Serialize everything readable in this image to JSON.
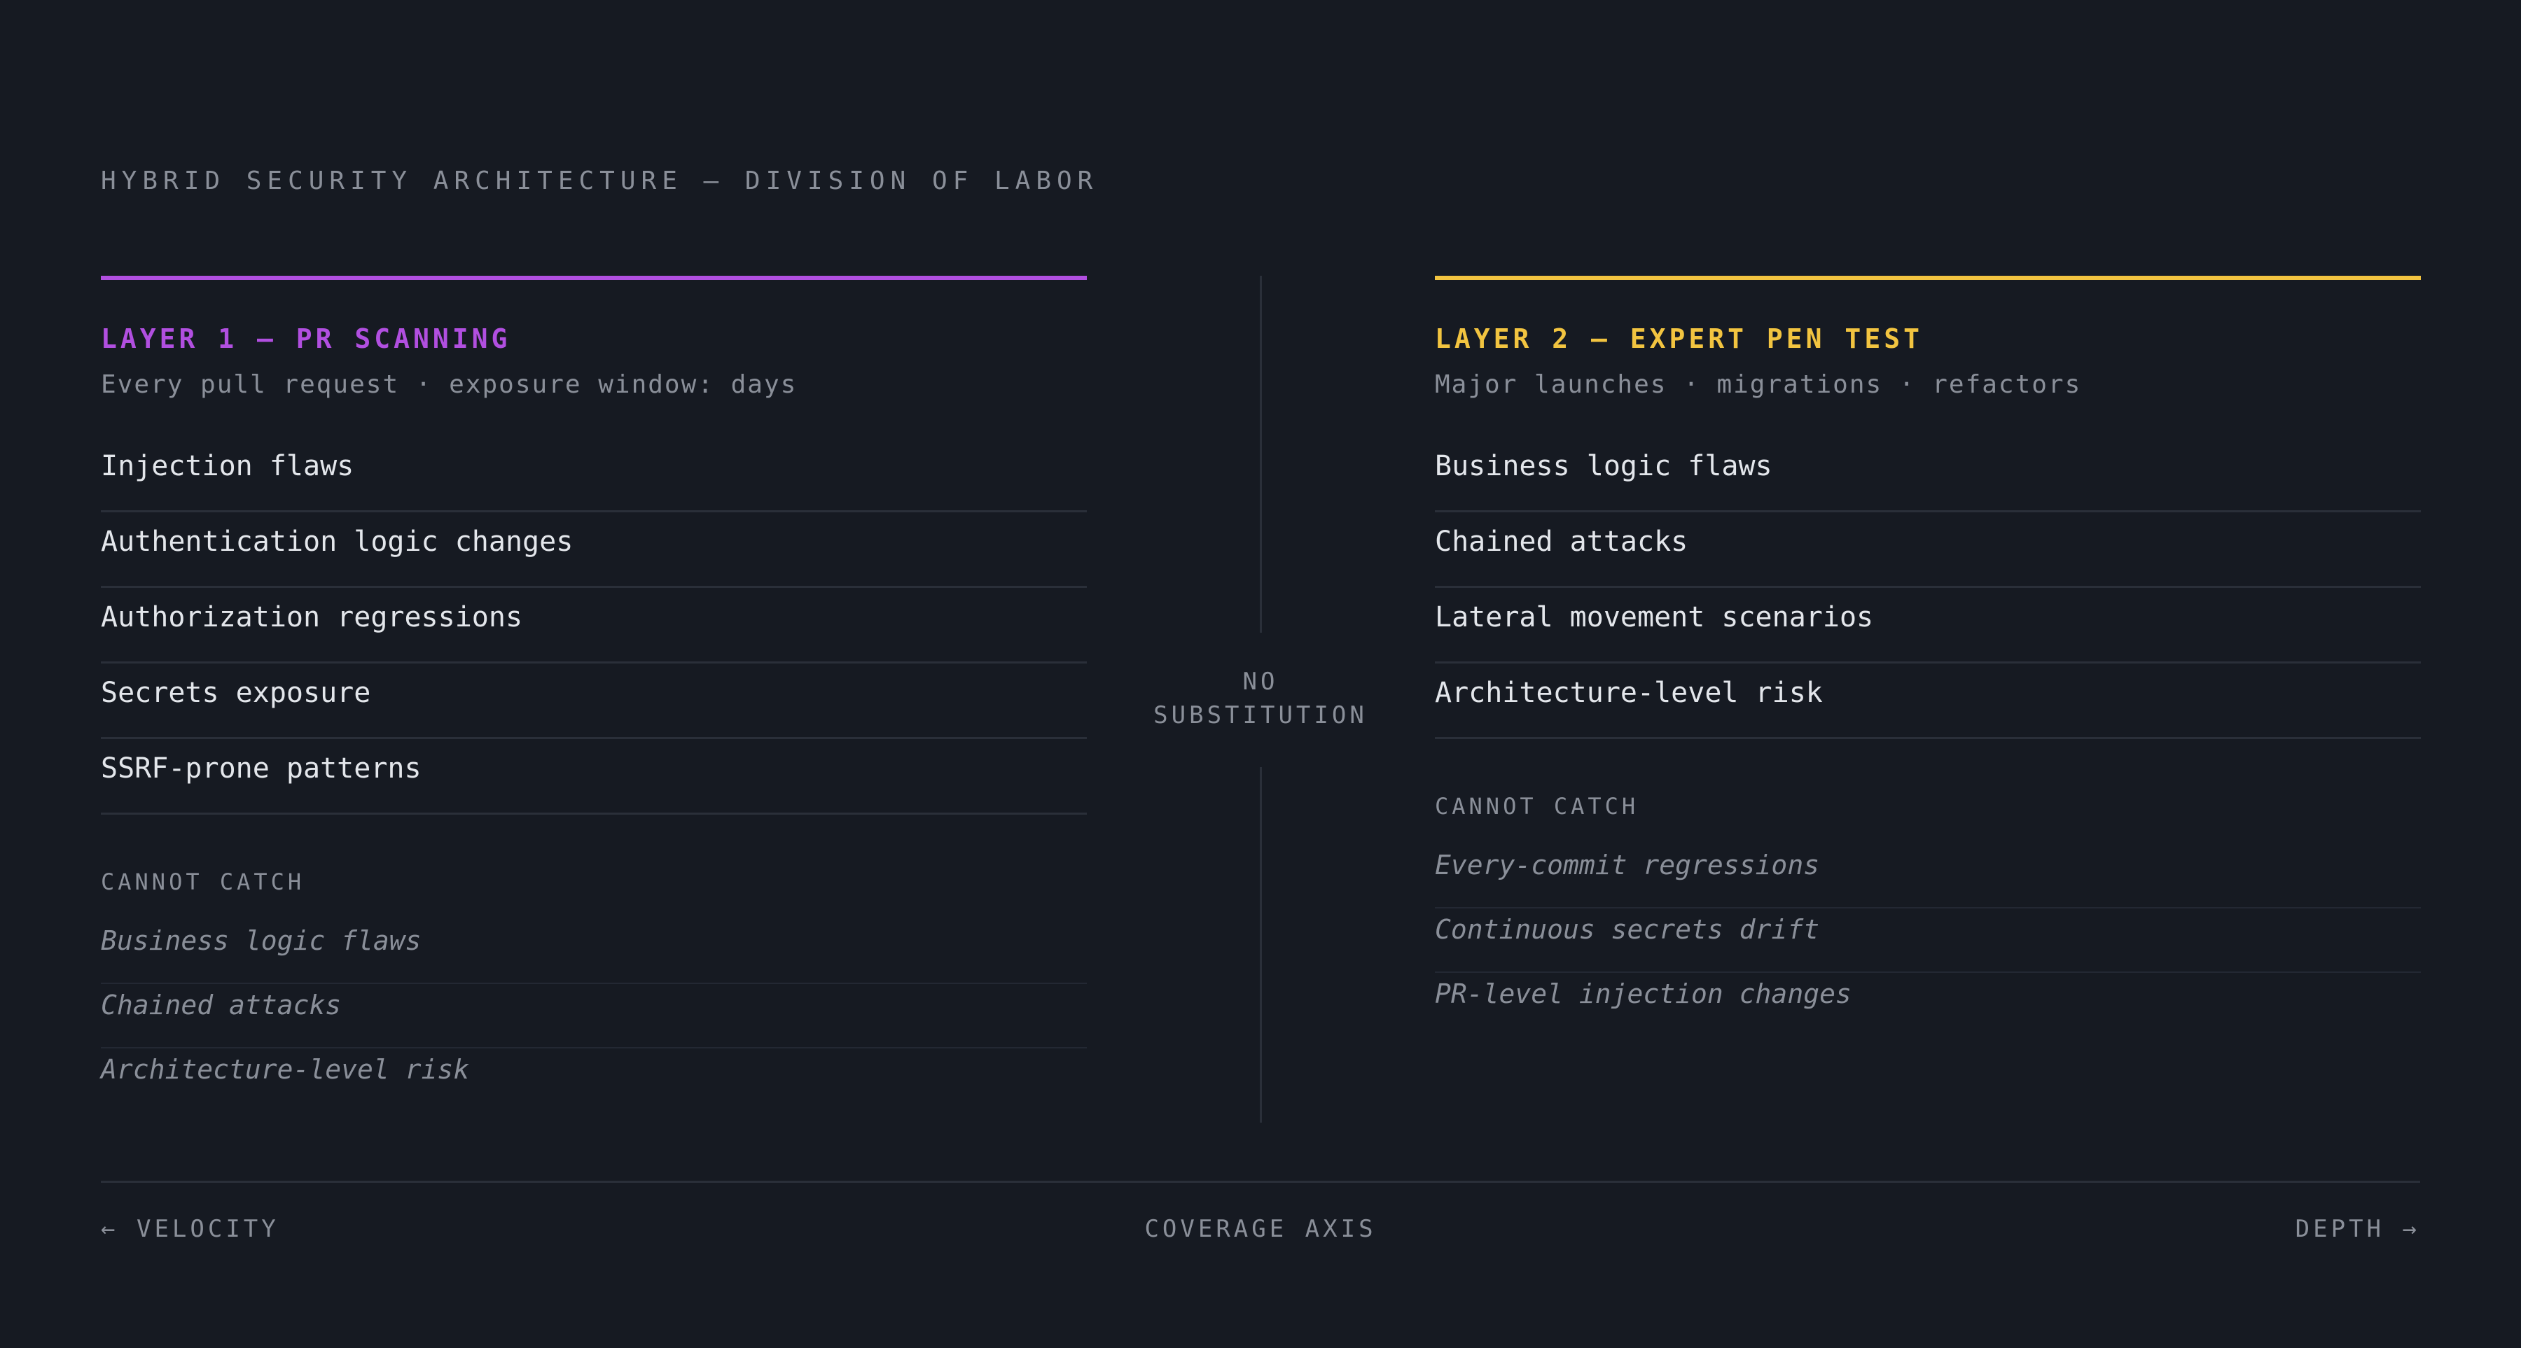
{
  "title": "HYBRID SECURITY ARCHITECTURE — DIVISION OF LABOR",
  "layer1": {
    "title": "LAYER 1 — PR SCANNING",
    "subtitle": "Every pull request · exposure window: days",
    "accent_color": "#b14fe0",
    "items": [
      "Injection flaws",
      "Authentication logic changes",
      "Authorization regressions",
      "Secrets exposure",
      "SSRF-prone patterns"
    ],
    "cannot_catch_label": "CANNOT CATCH",
    "cannot_catch": [
      "Business logic flaws",
      "Chained attacks",
      "Architecture-level risk"
    ]
  },
  "layer2": {
    "title": "LAYER 2 — EXPERT PEN TEST",
    "subtitle": "Major launches · migrations · refactors",
    "accent_color": "#f2c440",
    "items": [
      "Business logic flaws",
      "Chained attacks",
      "Lateral movement scenarios",
      "Architecture-level risk"
    ],
    "cannot_catch_label": "CANNOT CATCH",
    "cannot_catch": [
      "Every-commit regressions",
      "Continuous secrets drift",
      "PR-level injection changes"
    ]
  },
  "divider": {
    "line1": "NO",
    "line2": "SUBSTITUTION"
  },
  "axis": {
    "left_arrow": "←",
    "left_label": "VELOCITY",
    "center_label": "COVERAGE AXIS",
    "right_label": "DEPTH",
    "right_arrow": "→"
  }
}
